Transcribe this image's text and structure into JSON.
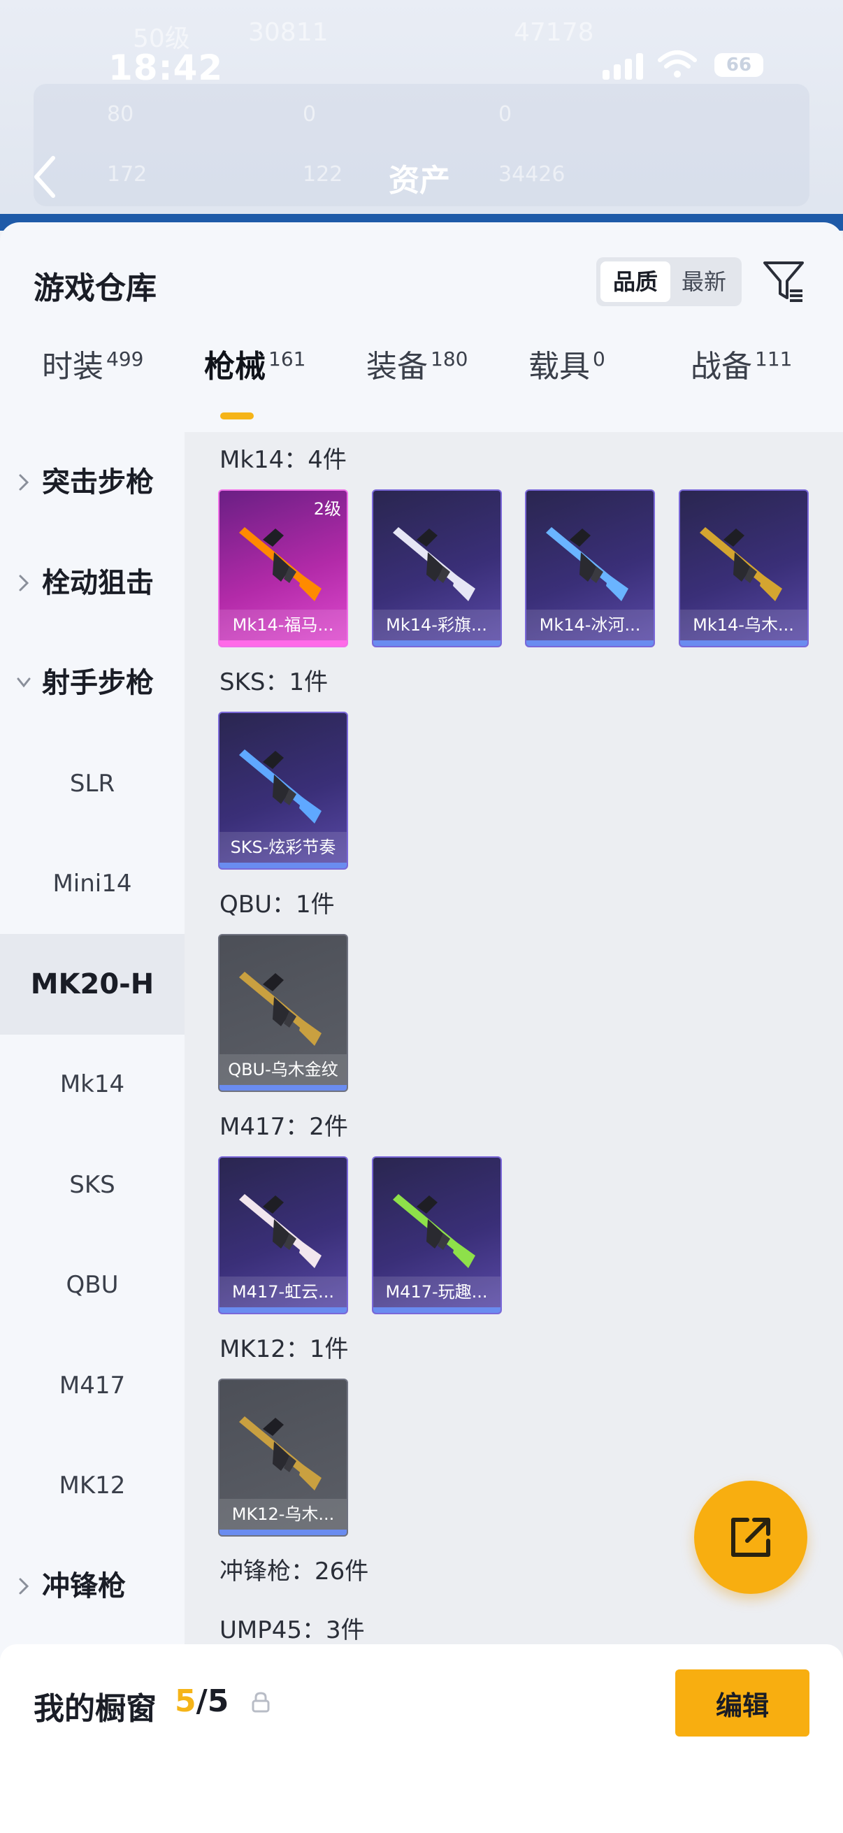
{
  "status_bar": {
    "time": "18:42",
    "battery": "66"
  },
  "header_bg": {
    "level": "50级",
    "coins": "30811",
    "score": "47178",
    "stat_1": "80",
    "stat_2": "0",
    "stat_3": "0",
    "stat_4": "172",
    "stat_5": "122",
    "stat_6": "34426",
    "title": "资产"
  },
  "panel": {
    "title": "游戏仓库",
    "sort_options": [
      "品质",
      "最新"
    ],
    "tabs": [
      {
        "label": "时装",
        "count": "499"
      },
      {
        "label": "枪械",
        "count": "161"
      },
      {
        "label": "装备",
        "count": "180"
      },
      {
        "label": "载具",
        "count": "0"
      },
      {
        "label": "战备",
        "count": "111"
      }
    ]
  },
  "sidebar": {
    "items": [
      {
        "label": "突击步枪",
        "type": "cat"
      },
      {
        "label": "栓动狙击",
        "type": "cat"
      },
      {
        "label": "射手步枪",
        "type": "cat-open"
      },
      {
        "label": "SLR",
        "type": "sub"
      },
      {
        "label": "Mini14",
        "type": "sub"
      },
      {
        "label": "MK20-H",
        "type": "sub-selected"
      },
      {
        "label": "Mk14",
        "type": "sub"
      },
      {
        "label": "SKS",
        "type": "sub"
      },
      {
        "label": "QBU",
        "type": "sub"
      },
      {
        "label": "M417",
        "type": "sub"
      },
      {
        "label": "MK12",
        "type": "sub"
      },
      {
        "label": "冲锋枪",
        "type": "cat"
      }
    ]
  },
  "groups": [
    {
      "label": "Mk14：4件",
      "items": [
        {
          "name": "Mk14-福马...",
          "style": "pink",
          "level": "2级",
          "accent": "#ff8a00"
        },
        {
          "name": "Mk14-彩旗...",
          "style": "purple",
          "accent": "#e6e6f5"
        },
        {
          "name": "Mk14-冰河...",
          "style": "purple",
          "accent": "#6ab4ff"
        },
        {
          "name": "Mk14-乌木...",
          "style": "purple",
          "accent": "#d4a530"
        }
      ]
    },
    {
      "label": "SKS：1件",
      "items": [
        {
          "name": "SKS-炫彩节奏",
          "style": "purple",
          "accent": "#5fa8ff"
        }
      ]
    },
    {
      "label": "QBU：1件",
      "items": [
        {
          "name": "QBU-乌木金纹",
          "style": "gray",
          "accent": "#c9a040"
        }
      ]
    },
    {
      "label": "M417：2件",
      "items": [
        {
          "name": "M417-虹云...",
          "style": "purple",
          "accent": "#f2e6ee"
        },
        {
          "name": "M417-玩趣...",
          "style": "purple",
          "accent": "#8ee04a"
        }
      ]
    },
    {
      "label": "MK12：1件",
      "items": [
        {
          "name": "MK12-乌木...",
          "style": "gray",
          "accent": "#c9a040"
        }
      ]
    },
    {
      "label": "冲锋枪：26件",
      "items": []
    },
    {
      "label": "UMP45：3件",
      "items": []
    }
  ],
  "bottom": {
    "title": "我的橱窗",
    "count_current": "5",
    "count_total": "/5",
    "edit_label": "编辑"
  },
  "colors": {
    "accent": "#f8ae10",
    "tab_indicator": "#f5b418"
  }
}
